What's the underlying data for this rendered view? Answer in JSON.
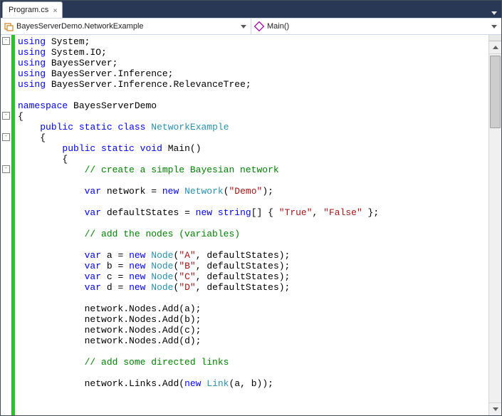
{
  "tab": {
    "title": "Program.cs",
    "close_glyph": "×"
  },
  "nav": {
    "class_label": "BayesServerDemo.NetworkExample",
    "member_label": "Main()"
  },
  "outline": {
    "glyph": "-"
  },
  "code": {
    "kw_using": "using",
    "kw_namespace": "namespace",
    "kw_public": "public",
    "kw_static": "static",
    "kw_class": "class",
    "kw_void": "void",
    "kw_var": "var",
    "kw_new": "new",
    "kw_string": "string",
    "ns_system": "System",
    "ns_system_io": "System.IO",
    "ns_bayes": "BayesServer",
    "ns_bayes_inf": "BayesServer.Inference",
    "ns_bayes_rel": "BayesServer.Inference.RelevanceTree",
    "ns_demo": "BayesServerDemo",
    "cls_name": "NetworkExample",
    "method_name": "Main",
    "t_network": "Network",
    "t_node": "Node",
    "t_link": "Link",
    "c_simple": "// create a simple Bayesian network",
    "c_addnodes": "// add the nodes (variables)",
    "c_addlinks": "// add some directed links",
    "s_demo": "\"Demo\"",
    "s_true": "\"True\"",
    "s_false": "\"False\"",
    "s_a": "\"A\"",
    "s_b": "\"B\"",
    "s_c": "\"C\"",
    "s_d": "\"D\"",
    "v_network": "network",
    "v_defaultStates": "defaultStates",
    "v_a": "a",
    "v_b": "b",
    "v_c": "c",
    "v_d": "d",
    "m_nodes_add": ".Nodes.Add(",
    "m_links_add": ".Links.Add("
  }
}
